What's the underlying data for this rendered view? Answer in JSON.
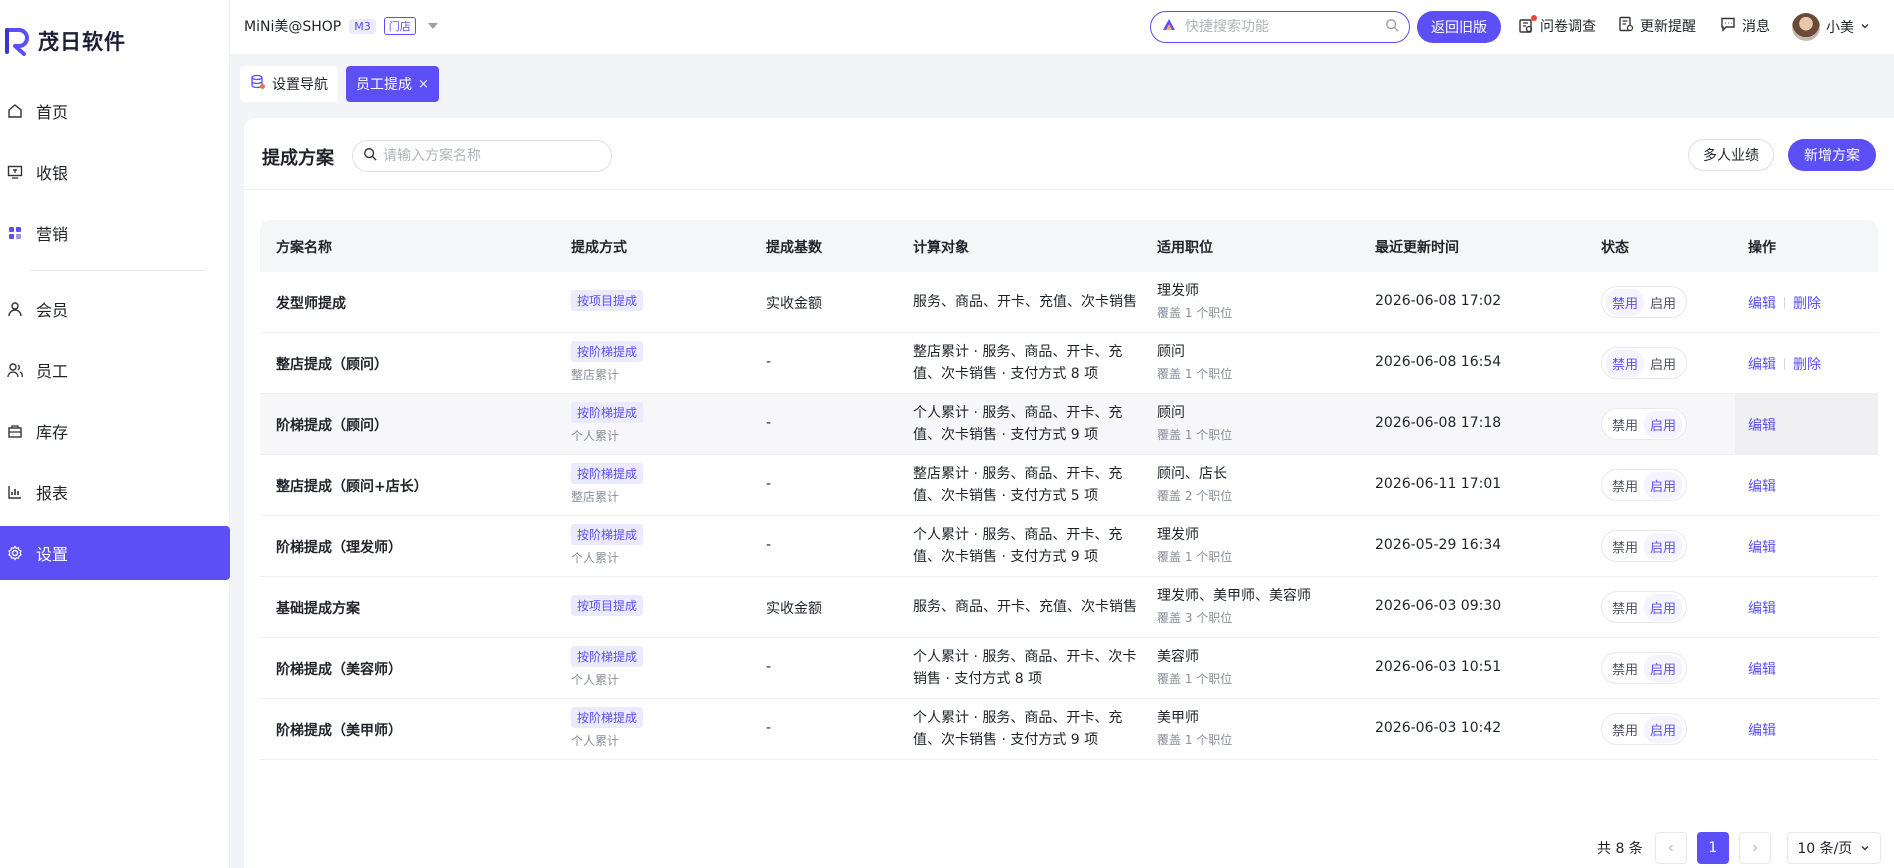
{
  "app": {
    "logo_text": "茂日软件"
  },
  "sidebar": {
    "items": [
      {
        "label": "首页",
        "icon": "home-icon"
      },
      {
        "label": "收银",
        "icon": "cashier-icon"
      },
      {
        "label": "营销",
        "icon": "marketing-icon"
      },
      {
        "label": "会员",
        "icon": "member-icon"
      },
      {
        "label": "员工",
        "icon": "staff-icon"
      },
      {
        "label": "库存",
        "icon": "inventory-icon"
      },
      {
        "label": "报表",
        "icon": "report-icon"
      },
      {
        "label": "设置",
        "icon": "gear-icon",
        "active": true
      }
    ]
  },
  "topbar": {
    "shop_name": "MiNi美@SHOP",
    "tag_version": "M3",
    "tag_store": "门店",
    "search_placeholder": "快捷搜索功能",
    "back_old_label": "返回旧版",
    "survey_label": "问卷调查",
    "update_label": "更新提醒",
    "message_label": "消息",
    "user_name": "小美"
  },
  "tabs": [
    {
      "label": "设置导航",
      "active": false
    },
    {
      "label": "员工提成",
      "active": true,
      "close": "×"
    }
  ],
  "panel": {
    "title": "提成方案",
    "search_placeholder": "请输入方案名称",
    "multi_label": "多人业绩",
    "new_label": "新增方案"
  },
  "table": {
    "headers": [
      "方案名称",
      "提成方式",
      "提成基数",
      "计算对象",
      "适用职位",
      "最近更新时间",
      "状态",
      "操作"
    ],
    "rows": [
      {
        "name": "发型师提成",
        "method": "按项目提成",
        "method_sub": "",
        "base": "实收金额",
        "target": "服务、商品、开卡、充值、次卡销售",
        "position": "理发师",
        "position_sub": "覆盖 1 个职位",
        "time": "2026-06-08 17:02",
        "status_off": "禁用",
        "status_on": "启用",
        "active": "off",
        "ops": [
          "编辑",
          "删除"
        ]
      },
      {
        "name": "整店提成（顾问）",
        "method": "按阶梯提成",
        "method_sub": "整店累计",
        "base": "-",
        "target": "整店累计 · 服务、商品、开卡、充值、次卡销售 · 支付方式 8 项",
        "position": "顾问",
        "position_sub": "覆盖 1 个职位",
        "time": "2026-06-08 16:54",
        "status_off": "禁用",
        "status_on": "启用",
        "active": "off",
        "ops": [
          "编辑",
          "删除"
        ]
      },
      {
        "name": "阶梯提成（顾问）",
        "method": "按阶梯提成",
        "method_sub": "个人累计",
        "base": "-",
        "target": "个人累计 · 服务、商品、开卡、充值、次卡销售 · 支付方式 9 项",
        "position": "顾问",
        "position_sub": "覆盖 1 个职位",
        "time": "2026-06-08 17:18",
        "status_off": "禁用",
        "status_on": "启用",
        "active": "on",
        "ops": [
          "编辑"
        ]
      },
      {
        "name": "整店提成（顾问+店长）",
        "method": "按阶梯提成",
        "method_sub": "整店累计",
        "base": "-",
        "target": "整店累计 · 服务、商品、开卡、充值、次卡销售 · 支付方式 5 项",
        "position": "顾问、店长",
        "position_sub": "覆盖 2 个职位",
        "time": "2026-06-11 17:01",
        "status_off": "禁用",
        "status_on": "启用",
        "active": "on",
        "ops": [
          "编辑"
        ]
      },
      {
        "name": "阶梯提成（理发师）",
        "method": "按阶梯提成",
        "method_sub": "个人累计",
        "base": "-",
        "target": "个人累计 · 服务、商品、开卡、充值、次卡销售 · 支付方式 9 项",
        "position": "理发师",
        "position_sub": "覆盖 1 个职位",
        "time": "2026-05-29 16:34",
        "status_off": "禁用",
        "status_on": "启用",
        "active": "on",
        "ops": [
          "编辑"
        ]
      },
      {
        "name": "基础提成方案",
        "method": "按项目提成",
        "method_sub": "",
        "base": "实收金额",
        "target": "服务、商品、开卡、充值、次卡销售",
        "position": "理发师、美甲师、美容师",
        "position_sub": "覆盖 3 个职位",
        "time": "2026-06-03 09:30",
        "status_off": "禁用",
        "status_on": "启用",
        "active": "on",
        "ops": [
          "编辑"
        ]
      },
      {
        "name": "阶梯提成（美容师）",
        "method": "按阶梯提成",
        "method_sub": "个人累计",
        "base": "-",
        "target": "个人累计 · 服务、商品、开卡、次卡销售 · 支付方式 8 项",
        "position": "美容师",
        "position_sub": "覆盖 1 个职位",
        "time": "2026-06-03 10:51",
        "status_off": "禁用",
        "status_on": "启用",
        "active": "on",
        "ops": [
          "编辑"
        ]
      },
      {
        "name": "阶梯提成（美甲师）",
        "method": "按阶梯提成",
        "method_sub": "个人累计",
        "base": "-",
        "target": "个人累计 · 服务、商品、开卡、充值、次卡销售 · 支付方式 9 项",
        "position": "美甲师",
        "position_sub": "覆盖 1 个职位",
        "time": "2026-06-03 10:42",
        "status_off": "禁用",
        "status_on": "启用",
        "active": "on",
        "ops": [
          "编辑"
        ]
      }
    ]
  },
  "pager": {
    "total": "共 8 条",
    "current": "1",
    "page_size": "10 条/页"
  },
  "colors": {
    "accent": "#5b4ff5",
    "accent_light": "#eceaff"
  }
}
